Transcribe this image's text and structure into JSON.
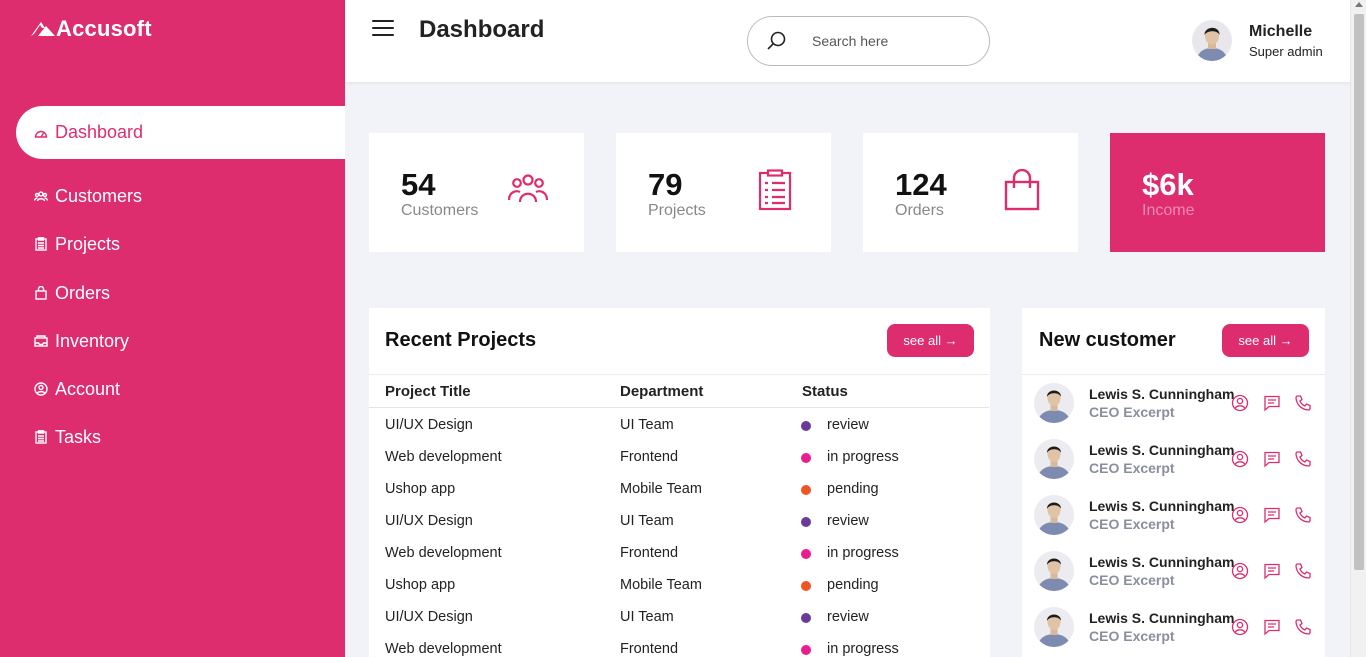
{
  "brand": {
    "name": "Accusoft"
  },
  "colors": {
    "accent": "#dd2d6e",
    "review": "#6a3a9e",
    "in_progress": "#e91e8c",
    "pending": "#ee5522"
  },
  "sidebar": {
    "items": [
      {
        "label": "Dashboard",
        "icon": "dashboard-icon",
        "active": true
      },
      {
        "label": "Customers",
        "icon": "users-icon"
      },
      {
        "label": "Projects",
        "icon": "clipboard-icon"
      },
      {
        "label": "Orders",
        "icon": "bag-icon"
      },
      {
        "label": "Inventory",
        "icon": "inbox-icon"
      },
      {
        "label": "Account",
        "icon": "user-circle-icon"
      },
      {
        "label": "Tasks",
        "icon": "clipboard-icon"
      }
    ]
  },
  "header": {
    "title": "Dashboard",
    "search_placeholder": "Search here",
    "user": {
      "name": "Michelle",
      "role": "Super admin"
    }
  },
  "stats": [
    {
      "value": "54",
      "label": "Customers",
      "icon": "users-icon"
    },
    {
      "value": "79",
      "label": "Projects",
      "icon": "clipboard-icon"
    },
    {
      "value": "124",
      "label": "Orders",
      "icon": "bag-icon"
    },
    {
      "value": "$6k",
      "label": "Income"
    }
  ],
  "recent_projects": {
    "title": "Recent Projects",
    "see_all": "see all →",
    "columns": [
      "Project Title",
      "Department",
      "Status"
    ],
    "rows": [
      {
        "title": "UI/UX Design",
        "department": "UI Team",
        "status": "review"
      },
      {
        "title": "Web development",
        "department": "Frontend",
        "status": "in progress"
      },
      {
        "title": "Ushop app",
        "department": "Mobile Team",
        "status": "pending"
      },
      {
        "title": "UI/UX Design",
        "department": "UI Team",
        "status": "review"
      },
      {
        "title": "Web development",
        "department": "Frontend",
        "status": "in progress"
      },
      {
        "title": "Ushop app",
        "department": "Mobile Team",
        "status": "pending"
      },
      {
        "title": "UI/UX Design",
        "department": "UI Team",
        "status": "review"
      },
      {
        "title": "Web development",
        "department": "Frontend",
        "status": "in progress"
      }
    ]
  },
  "new_customers": {
    "title": "New customer",
    "see_all": "see all →",
    "rows": [
      {
        "name": "Lewis S. Cunningham",
        "title": "CEO Excerpt"
      },
      {
        "name": "Lewis S. Cunningham",
        "title": "CEO Excerpt"
      },
      {
        "name": "Lewis S. Cunningham",
        "title": "CEO Excerpt"
      },
      {
        "name": "Lewis S. Cunningham",
        "title": "CEO Excerpt"
      },
      {
        "name": "Lewis S. Cunningham",
        "title": "CEO Excerpt"
      }
    ]
  }
}
